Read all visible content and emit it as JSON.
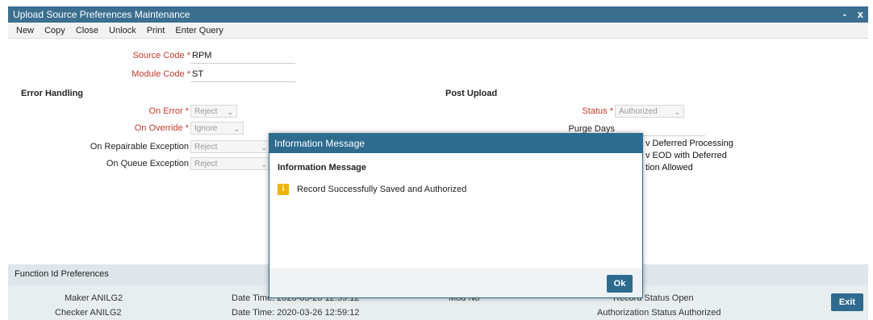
{
  "window": {
    "title": "Upload Source Preferences Maintenance",
    "min": "-",
    "close": "x"
  },
  "menu": [
    "New",
    "Copy",
    "Close",
    "Unlock",
    "Print",
    "Enter Query"
  ],
  "fields": {
    "source_code_label": "Source Code",
    "source_code_value": "RPM",
    "module_code_label": "Module Code",
    "module_code_value": "ST",
    "required_mark": "*"
  },
  "error_handling": {
    "title": "Error Handling",
    "on_error_label": "On Error",
    "on_error_value": "Reject",
    "on_override_label": "On Override",
    "on_override_value": "Ignore",
    "on_repairable_label": "On Repairable Exception",
    "on_repairable_value": "Reject",
    "on_queue_label": "On Queue Exception",
    "on_queue_value": "Reject"
  },
  "post_upload": {
    "title": "Post Upload",
    "status_label": "Status",
    "status_value": "Authorized",
    "purge_days_label": "Purge Days",
    "deferred_processing": "v Deferred Processing",
    "eod_deferred": "v EOD with Deferred",
    "allowed": "tion Allowed"
  },
  "footer": {
    "function_id": "Function Id Preferences",
    "maker": "Maker ANILG2",
    "maker_date": "Date Time: 2020-03-26 12:59:12",
    "checker": "Checker ANILG2",
    "checker_date": "Date Time: 2020-03-26 12:59:12",
    "record_status": "Record Status Open",
    "auth_status": "Authorization Status Authorized",
    "mod_no": "Mod No",
    "exit": "Exit"
  },
  "dialog": {
    "title": "Information Message",
    "subtitle": "Information Message",
    "message": "Record Successfully Saved and Authorized",
    "ok": "Ok",
    "icon_glyph": "i"
  }
}
